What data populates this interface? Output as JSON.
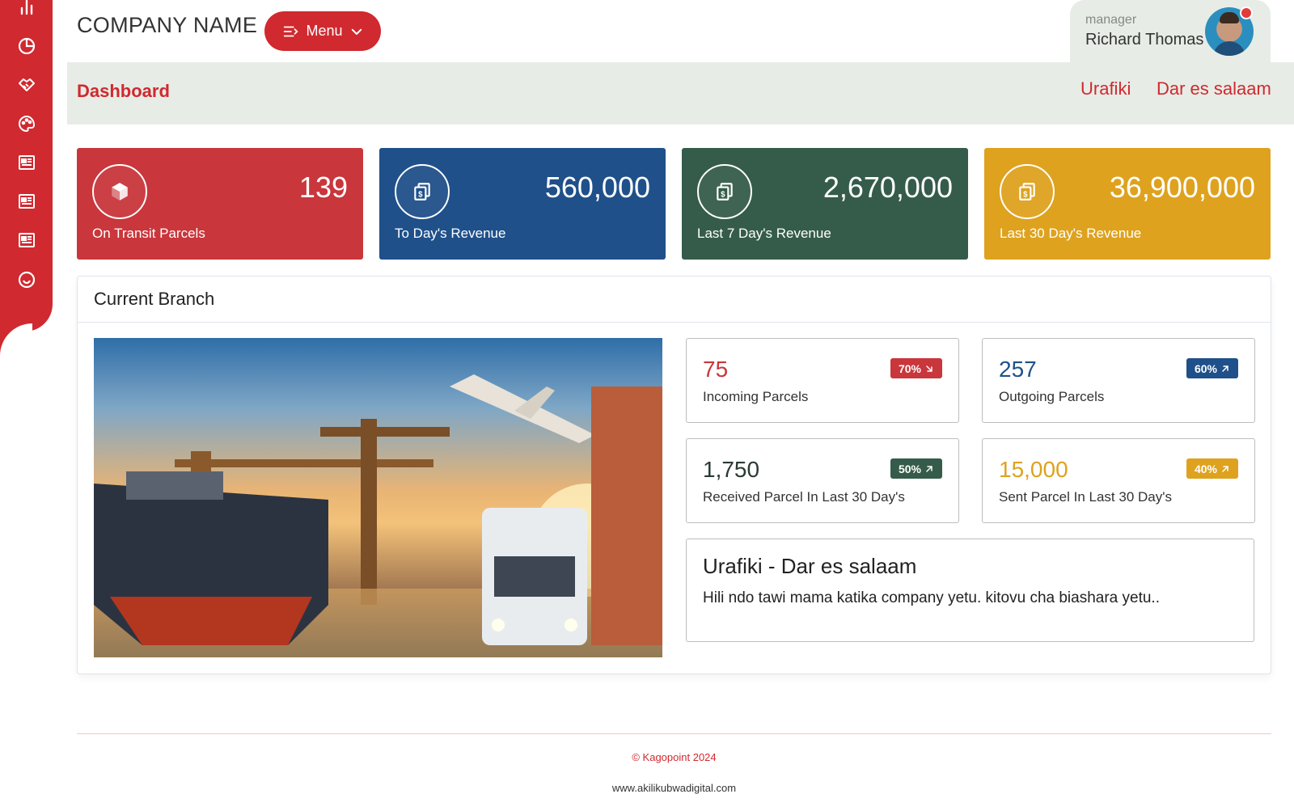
{
  "sidebar": {
    "items": [
      {
        "icon": "bar-chart-icon"
      },
      {
        "icon": "pie-chart-icon"
      },
      {
        "icon": "handshake-icon"
      },
      {
        "icon": "palette-icon"
      },
      {
        "icon": "newspaper-icon"
      },
      {
        "icon": "newspaper-icon"
      },
      {
        "icon": "newspaper-icon"
      },
      {
        "icon": "smiley-icon"
      }
    ]
  },
  "header": {
    "company": "COMPANY NAME",
    "menu_label": "Menu",
    "user_role": "manager",
    "user_name": "Richard Thomas"
  },
  "subbar": {
    "title": "Dashboard",
    "location_1": "Urafiki",
    "location_2": "Dar es salaam"
  },
  "stats": [
    {
      "value": "139",
      "label": "On Transit Parcels",
      "color": "#c9363b",
      "icon": "box-icon"
    },
    {
      "value": "560,000",
      "label": "To Day's Revenue",
      "color": "#1f508a",
      "icon": "money-icon"
    },
    {
      "value": "2,670,000",
      "label": "Last 7 Day's Revenue",
      "color": "#355c4a",
      "icon": "money-icon"
    },
    {
      "value": "36,900,000",
      "label": "Last 30 Day's Revenue",
      "color": "#dea21e",
      "icon": "money-icon"
    }
  ],
  "branch": {
    "title": "Current Branch",
    "cards": [
      {
        "value": "75",
        "label": "Incoming Parcels",
        "badge": "70%",
        "color": "#c9363b",
        "arrow": "down-right"
      },
      {
        "value": "257",
        "label": "Outgoing Parcels",
        "badge": "60%",
        "color": "#1f508a",
        "arrow": "up-right"
      },
      {
        "value": "1,750",
        "label": "Received Parcel In Last 30 Day's",
        "badge": "50%",
        "color": "#355c4a",
        "arrow": "up-right"
      },
      {
        "value": "15,000",
        "label": "Sent Parcel In Last 30 Day's",
        "badge": "40%",
        "color": "#dea21e",
        "arrow": "up-right"
      }
    ],
    "info_title": "Urafiki - Dar es salaam",
    "info_desc": "Hili ndo tawi mama katika company yetu. kitovu cha biashara yetu.."
  },
  "footer": {
    "copyright": "© Kagopoint 2024",
    "website": "www.akilikubwadigital.com"
  }
}
